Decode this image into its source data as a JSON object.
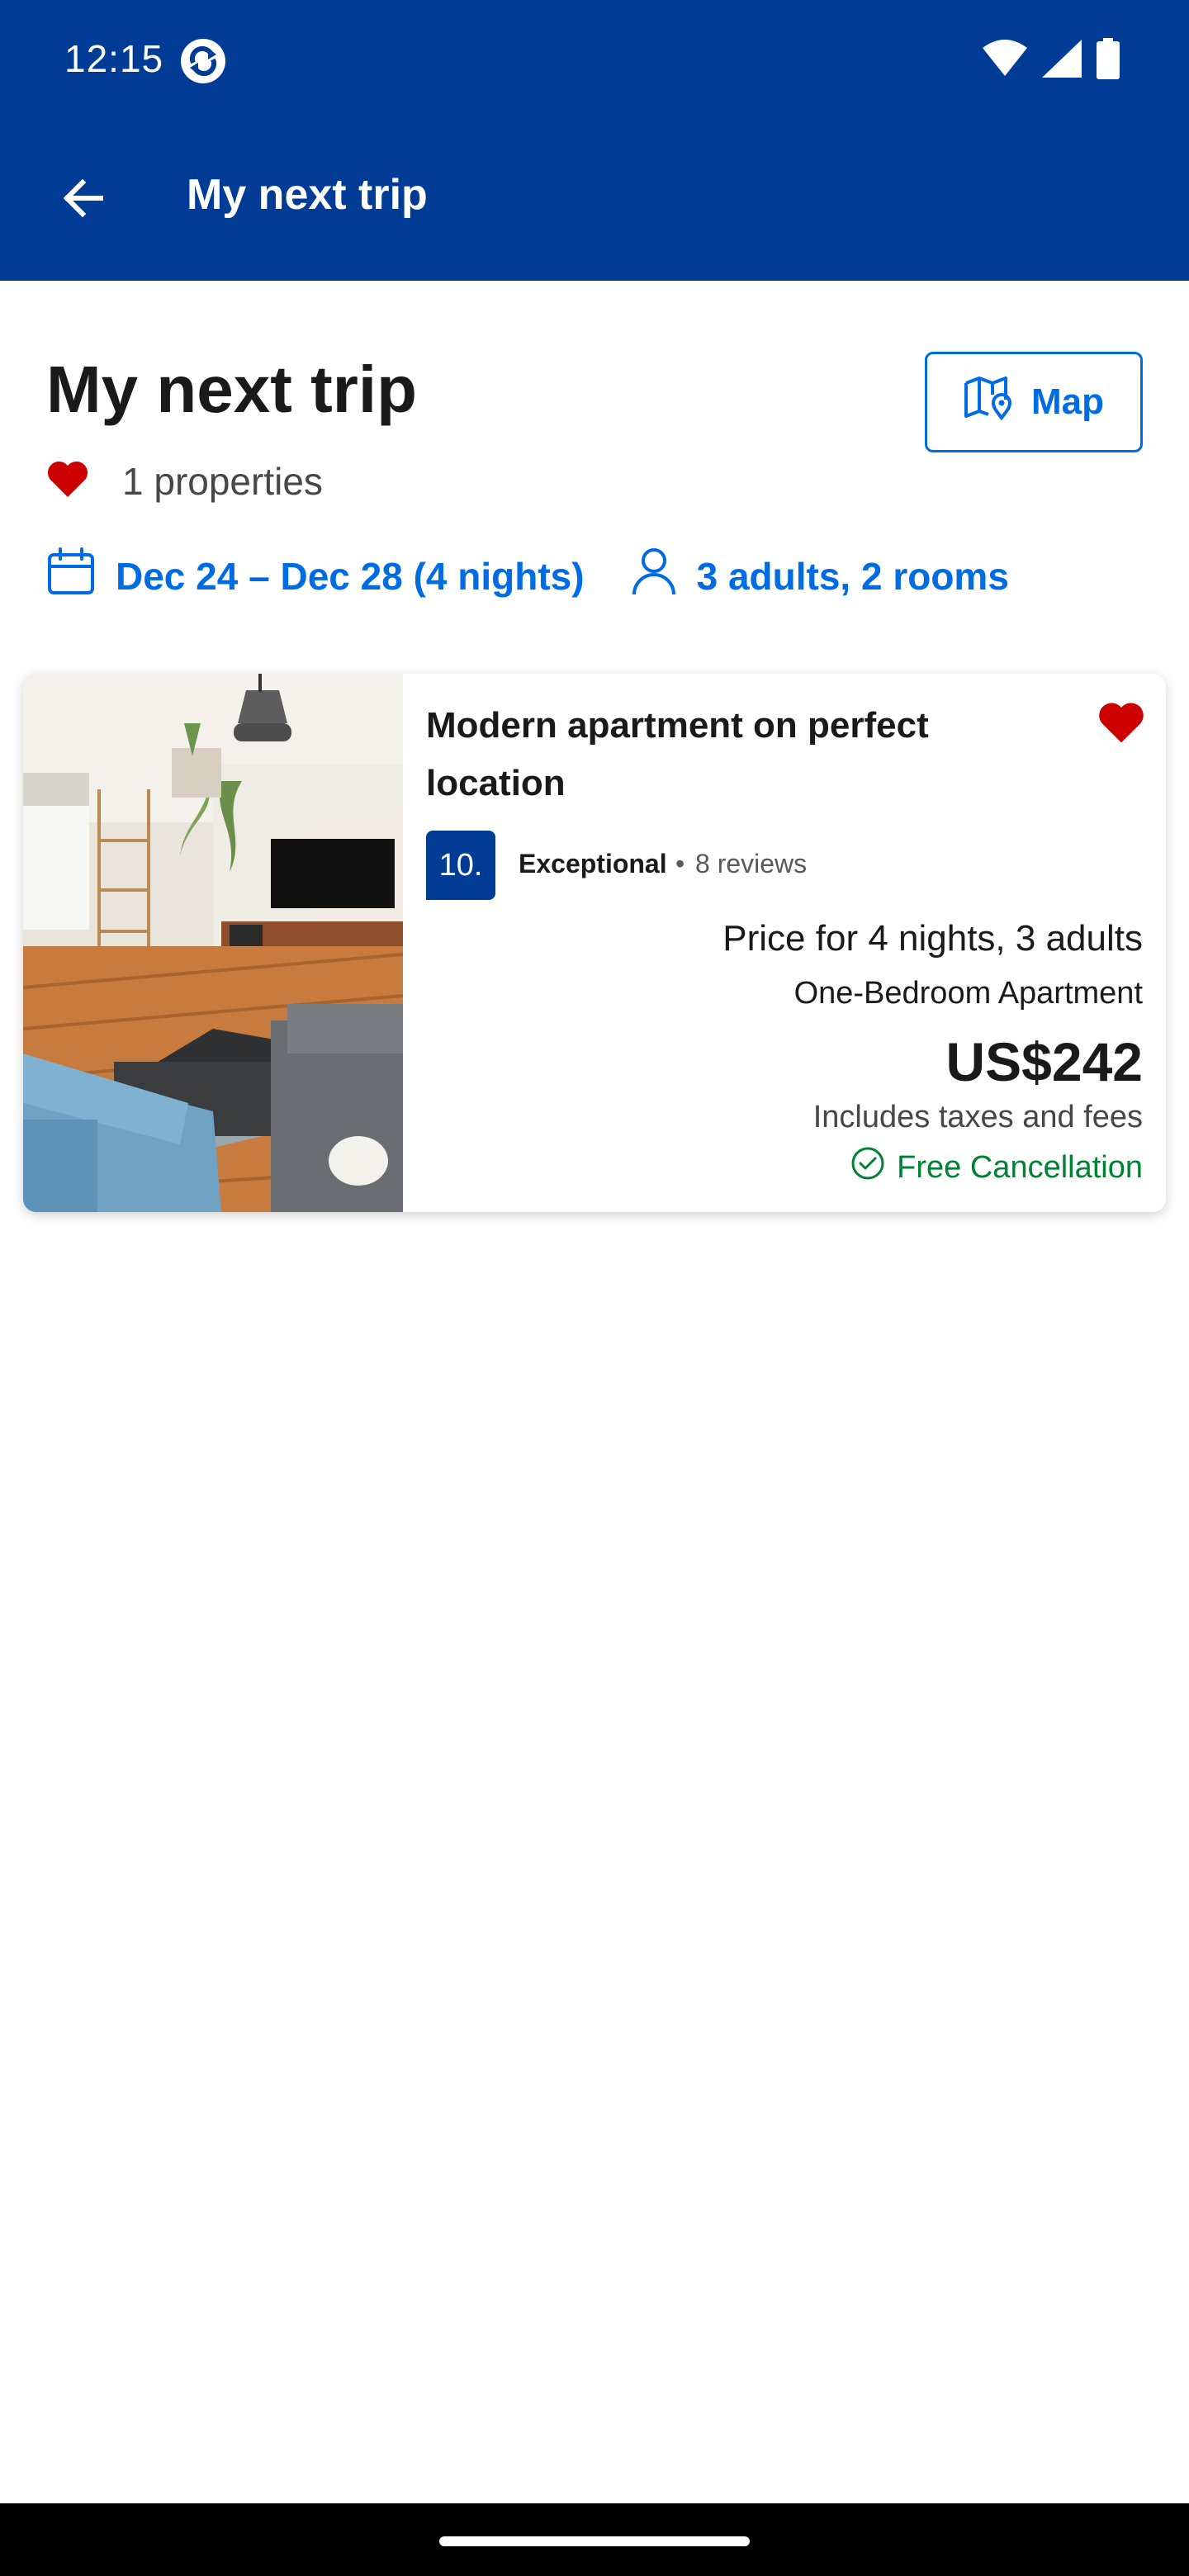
{
  "status_bar": {
    "time": "12:15",
    "icons": [
      "app-notification-icon",
      "wifi-icon",
      "signal-icon",
      "battery-icon"
    ]
  },
  "app_bar": {
    "title": "My next trip",
    "back_icon": "arrow-left-icon"
  },
  "header": {
    "title": "My next trip",
    "map_button_label": "Map",
    "properties_count_text": "1 properties"
  },
  "trip_meta": {
    "dates": "Dec 24 – Dec 28 (4 nights)",
    "guests": "3 adults, 2 rooms"
  },
  "property_card": {
    "title": "Modern apartment on perfect location",
    "score": "10.",
    "score_label": "Exceptional",
    "separator": "•",
    "reviews": "8 reviews",
    "price_caption": "Price for 4 nights, 3 adults",
    "room_type": "One-Bedroom Apartment",
    "price": "US$242",
    "taxes_note": "Includes taxes and fees",
    "free_cancellation": "Free Cancellation",
    "saved": true
  },
  "colors": {
    "brand_blue": "#003b95",
    "link_blue": "#006ce4",
    "saved_red": "#cc0000",
    "success_green": "#008234"
  }
}
